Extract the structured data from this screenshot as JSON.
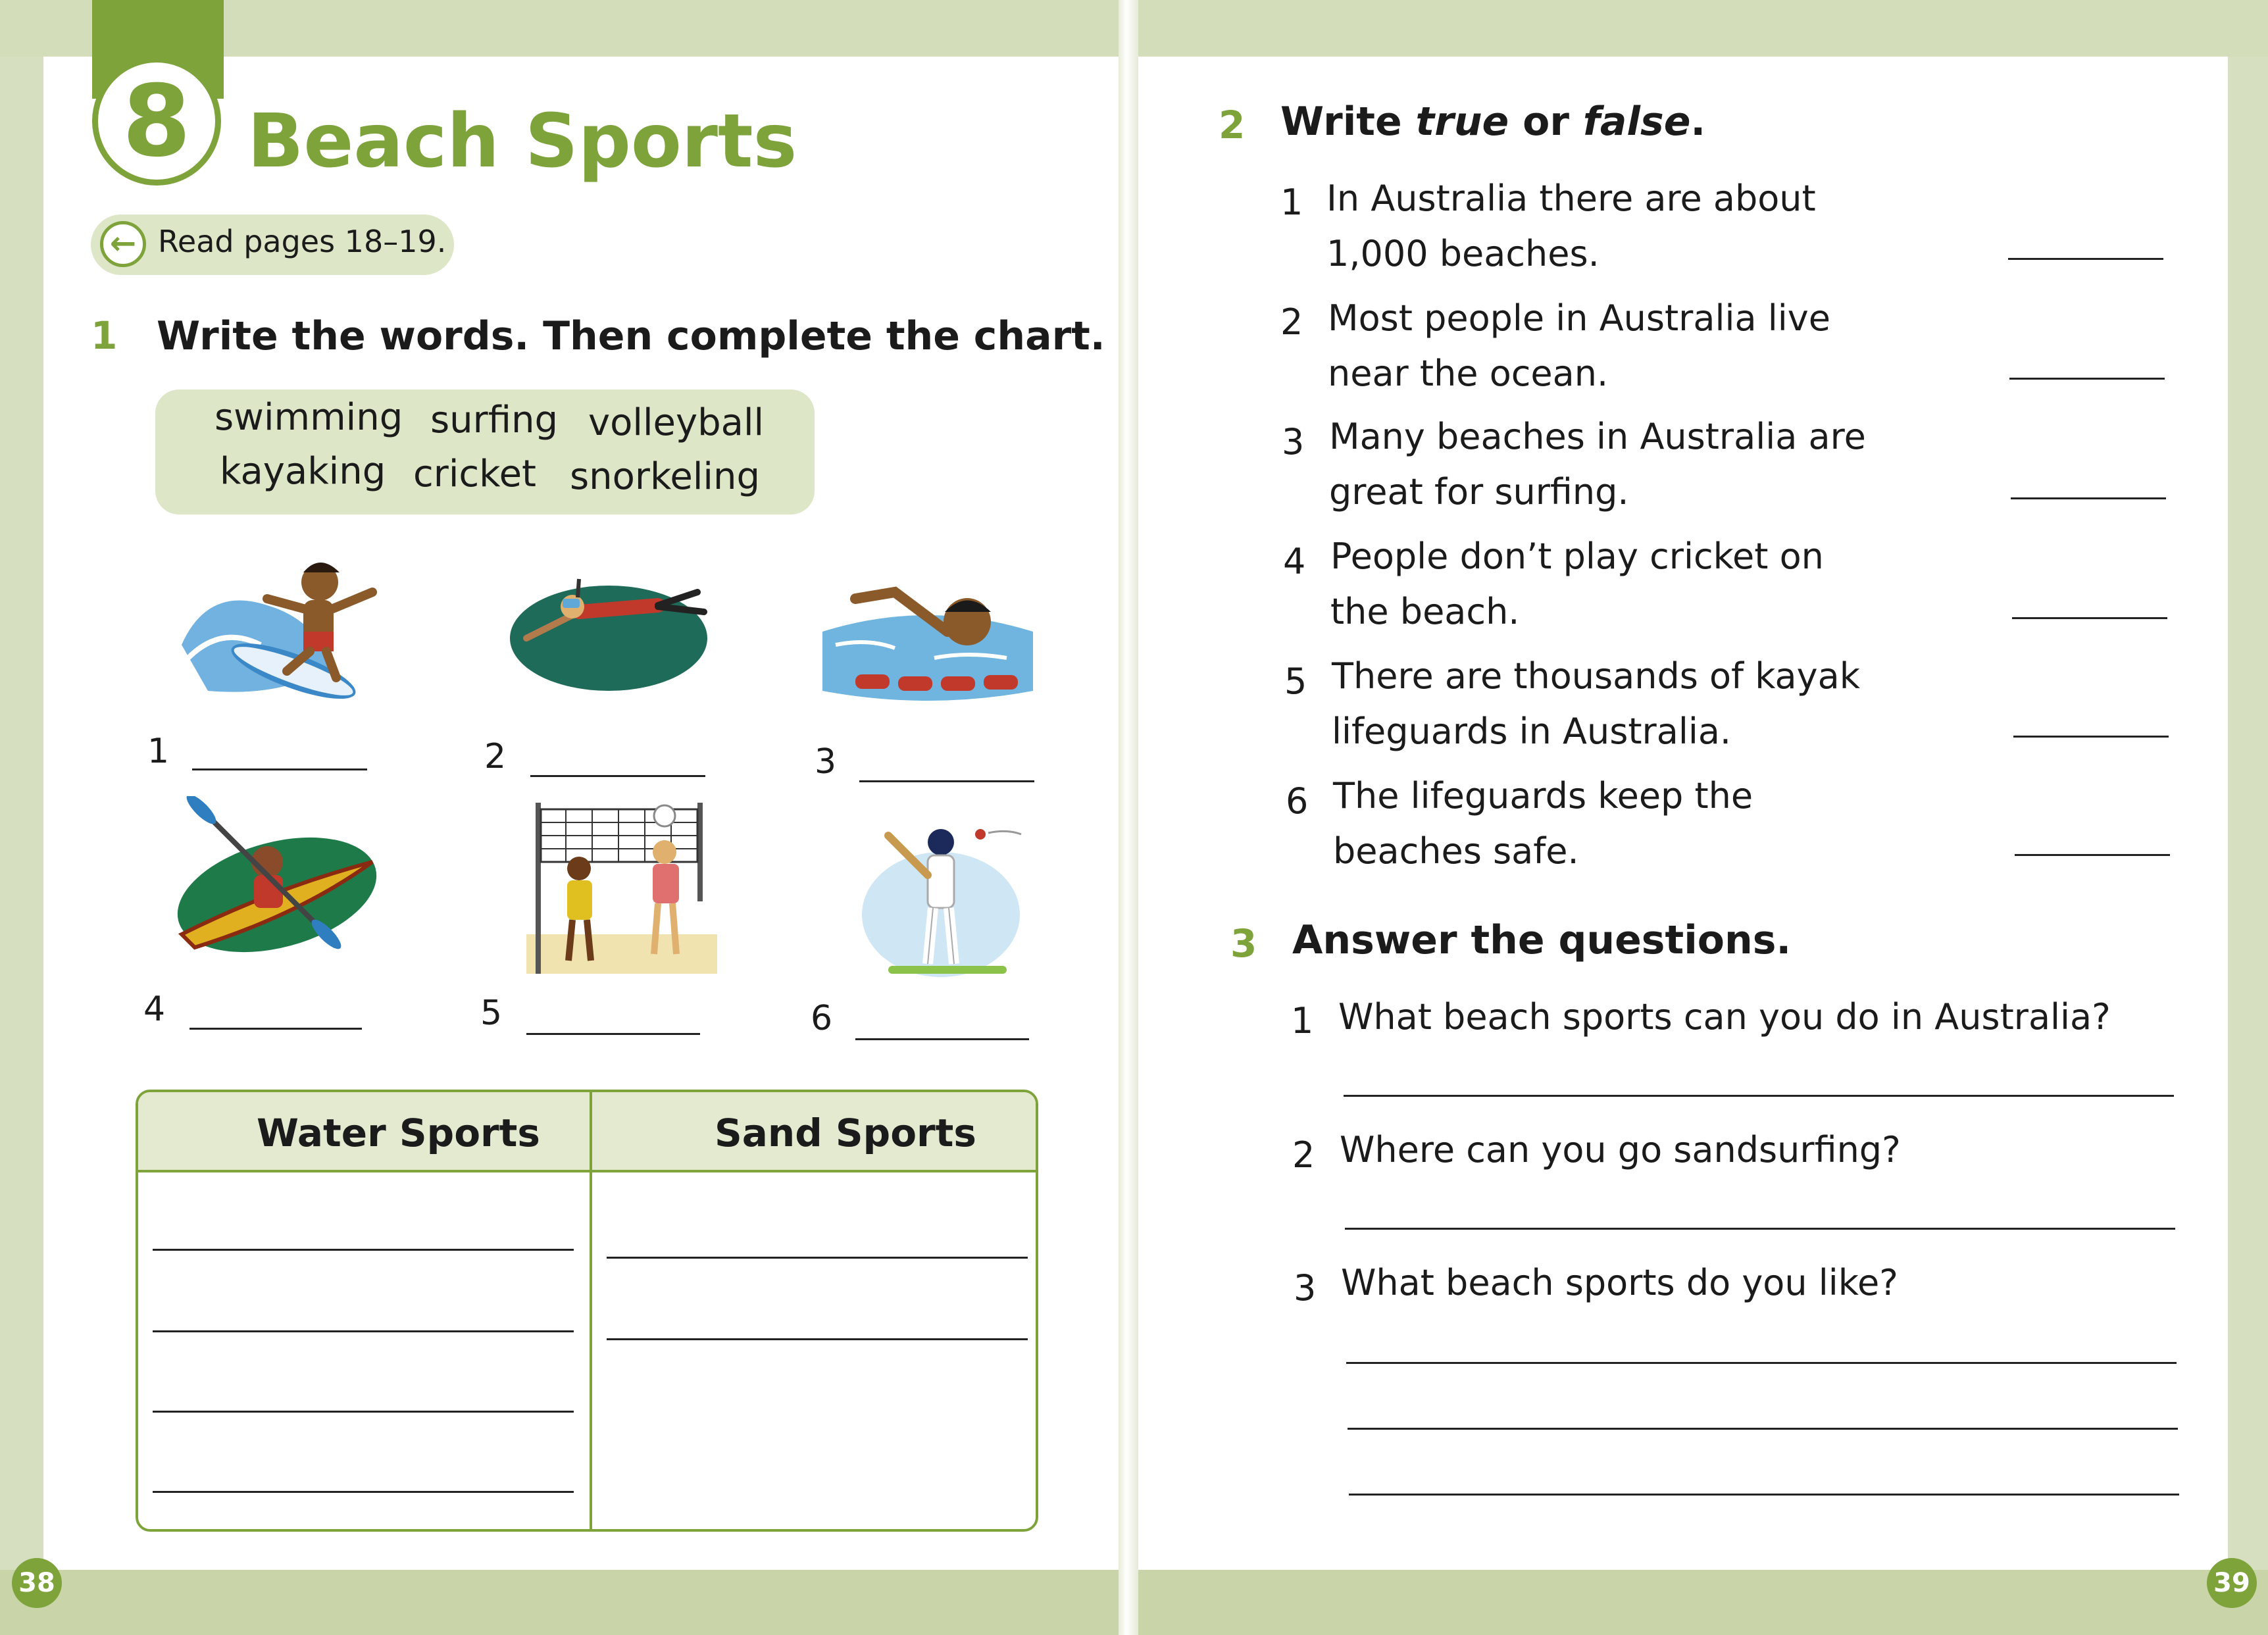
{
  "unit": {
    "number": "8",
    "title": "Beach Sports"
  },
  "read_pages": "Read pages 18–19.",
  "exercise1": {
    "number": "1",
    "instruction": "Write the words. Then complete the chart.",
    "words": [
      "swimming",
      "surfing",
      "volleyball",
      "kayaking",
      "cricket",
      "snorkeling"
    ],
    "pictures": [
      "1",
      "2",
      "3",
      "4",
      "5",
      "6"
    ],
    "chart": {
      "col1": "Water Sports",
      "col2": "Sand Sports"
    }
  },
  "exercise2": {
    "number": "2",
    "instruction_pre": "Write ",
    "instruction_true": "true",
    "instruction_mid": " or ",
    "instruction_false": "false",
    "instruction_end": ".",
    "items": [
      {
        "num": "1",
        "line1": "In Australia there are about",
        "line2": "1,000 beaches."
      },
      {
        "num": "2",
        "line1": "Most people in Australia live",
        "line2": "near the ocean."
      },
      {
        "num": "3",
        "line1": "Many beaches in Australia are",
        "line2": "great for surfing."
      },
      {
        "num": "4",
        "line1": "People don’t play cricket on",
        "line2": "the beach."
      },
      {
        "num": "5",
        "line1": "There are thousands of kayak",
        "line2": "lifeguards in Australia."
      },
      {
        "num": "6",
        "line1": "The lifeguards keep the",
        "line2": "beaches safe."
      }
    ]
  },
  "exercise3": {
    "number": "3",
    "instruction": "Answer the questions.",
    "questions": [
      {
        "num": "1",
        "text": "What beach sports can you do in Australia?"
      },
      {
        "num": "2",
        "text": "Where can you go sandsurfing?"
      },
      {
        "num": "3",
        "text": "What beach sports do you like?"
      }
    ]
  },
  "page_numbers": {
    "left": "38",
    "right": "39"
  },
  "colors": {
    "accent": "#7ea33a",
    "panel": "#dde6c6",
    "background": "#d6dfc0"
  }
}
